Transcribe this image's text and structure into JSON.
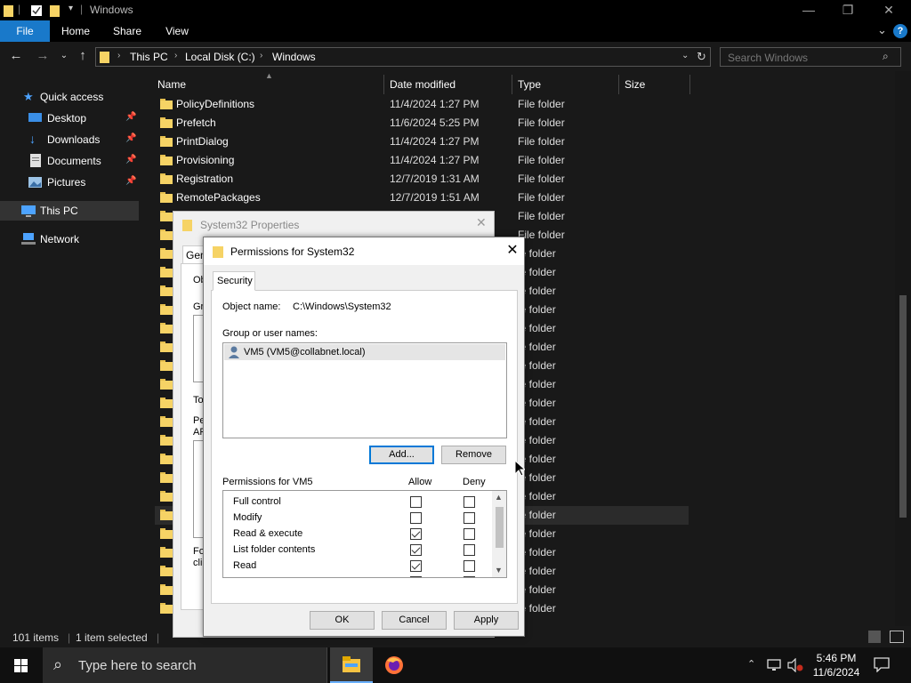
{
  "window": {
    "title": "Windows",
    "minimize": "—",
    "maximize": "❐",
    "close": "✕"
  },
  "ribbon": {
    "tabs": [
      "File",
      "Home",
      "Share",
      "View"
    ],
    "expand": "⌄",
    "help": "?"
  },
  "address": {
    "crumbs": [
      "This PC",
      "Local Disk (C:)",
      "Windows"
    ],
    "search_placeholder": "Search Windows"
  },
  "nav": {
    "items": [
      {
        "label": "Quick access",
        "icon": "star-icon",
        "pinned": false
      },
      {
        "label": "Desktop",
        "icon": "desktop-icon",
        "pinned": true
      },
      {
        "label": "Downloads",
        "icon": "download-icon",
        "pinned": true
      },
      {
        "label": "Documents",
        "icon": "documents-icon",
        "pinned": true
      },
      {
        "label": "Pictures",
        "icon": "pictures-icon",
        "pinned": true
      },
      {
        "label": "This PC",
        "icon": "pc-icon",
        "pinned": false
      },
      {
        "label": "Network",
        "icon": "network-icon",
        "pinned": false
      }
    ]
  },
  "columns": {
    "name": "Name",
    "date": "Date modified",
    "type": "Type",
    "size": "Size"
  },
  "files": [
    {
      "name": "PolicyDefinitions",
      "date": "11/4/2024 1:27 PM",
      "type": "File folder"
    },
    {
      "name": "Prefetch",
      "date": "11/6/2024 5:25 PM",
      "type": "File folder"
    },
    {
      "name": "PrintDialog",
      "date": "11/4/2024 1:27 PM",
      "type": "File folder"
    },
    {
      "name": "Provisioning",
      "date": "11/4/2024 1:27 PM",
      "type": "File folder"
    },
    {
      "name": "Registration",
      "date": "12/7/2019 1:31 AM",
      "type": "File folder"
    },
    {
      "name": "RemotePackages",
      "date": "12/7/2019 1:51 AM",
      "type": "File folder"
    }
  ],
  "partial_rows": [
    "File folder",
    "File folder",
    "le folder",
    "le folder",
    "le folder",
    "le folder",
    "le folder",
    "le folder",
    "le folder",
    "le folder",
    "le folder",
    "le folder",
    "le folder",
    "le folder",
    "le folder",
    "le folder",
    "le folder",
    "le folder",
    "le folder",
    "le folder",
    "le folder",
    "le folder"
  ],
  "status": {
    "items": "101 items",
    "selected": "1 item selected"
  },
  "properties_dialog": {
    "title": "System32 Properties",
    "close": "✕",
    "tab": "Gen",
    "fragments": [
      "Ob",
      "Gr",
      "To",
      "Pe",
      "AP",
      "Fo",
      "cli"
    ]
  },
  "permissions_dialog": {
    "title": "Permissions for System32",
    "close": "✕",
    "tab": "Security",
    "object_label": "Object name:",
    "object_value": "C:\\Windows\\System32",
    "group_label": "Group or user names:",
    "users": [
      "VM5 (VM5@collabnet.local)"
    ],
    "add_button": "Add...",
    "remove_button": "Remove",
    "perm_header": "Permissions for VM5",
    "allow_header": "Allow",
    "deny_header": "Deny",
    "permissions": [
      {
        "name": "Full control",
        "allow": false,
        "deny": false
      },
      {
        "name": "Modify",
        "allow": false,
        "deny": false
      },
      {
        "name": "Read & execute",
        "allow": true,
        "deny": false
      },
      {
        "name": "List folder contents",
        "allow": true,
        "deny": false
      },
      {
        "name": "Read",
        "allow": true,
        "deny": false
      }
    ],
    "ok_button": "OK",
    "cancel_button": "Cancel",
    "apply_button": "Apply"
  },
  "taskbar": {
    "search_placeholder": "Type here to search",
    "time": "5:46 PM",
    "date": "11/6/2024"
  },
  "colors": {
    "accent": "#1979ca",
    "folder": "#f6d365",
    "dark_bg": "#191919"
  }
}
